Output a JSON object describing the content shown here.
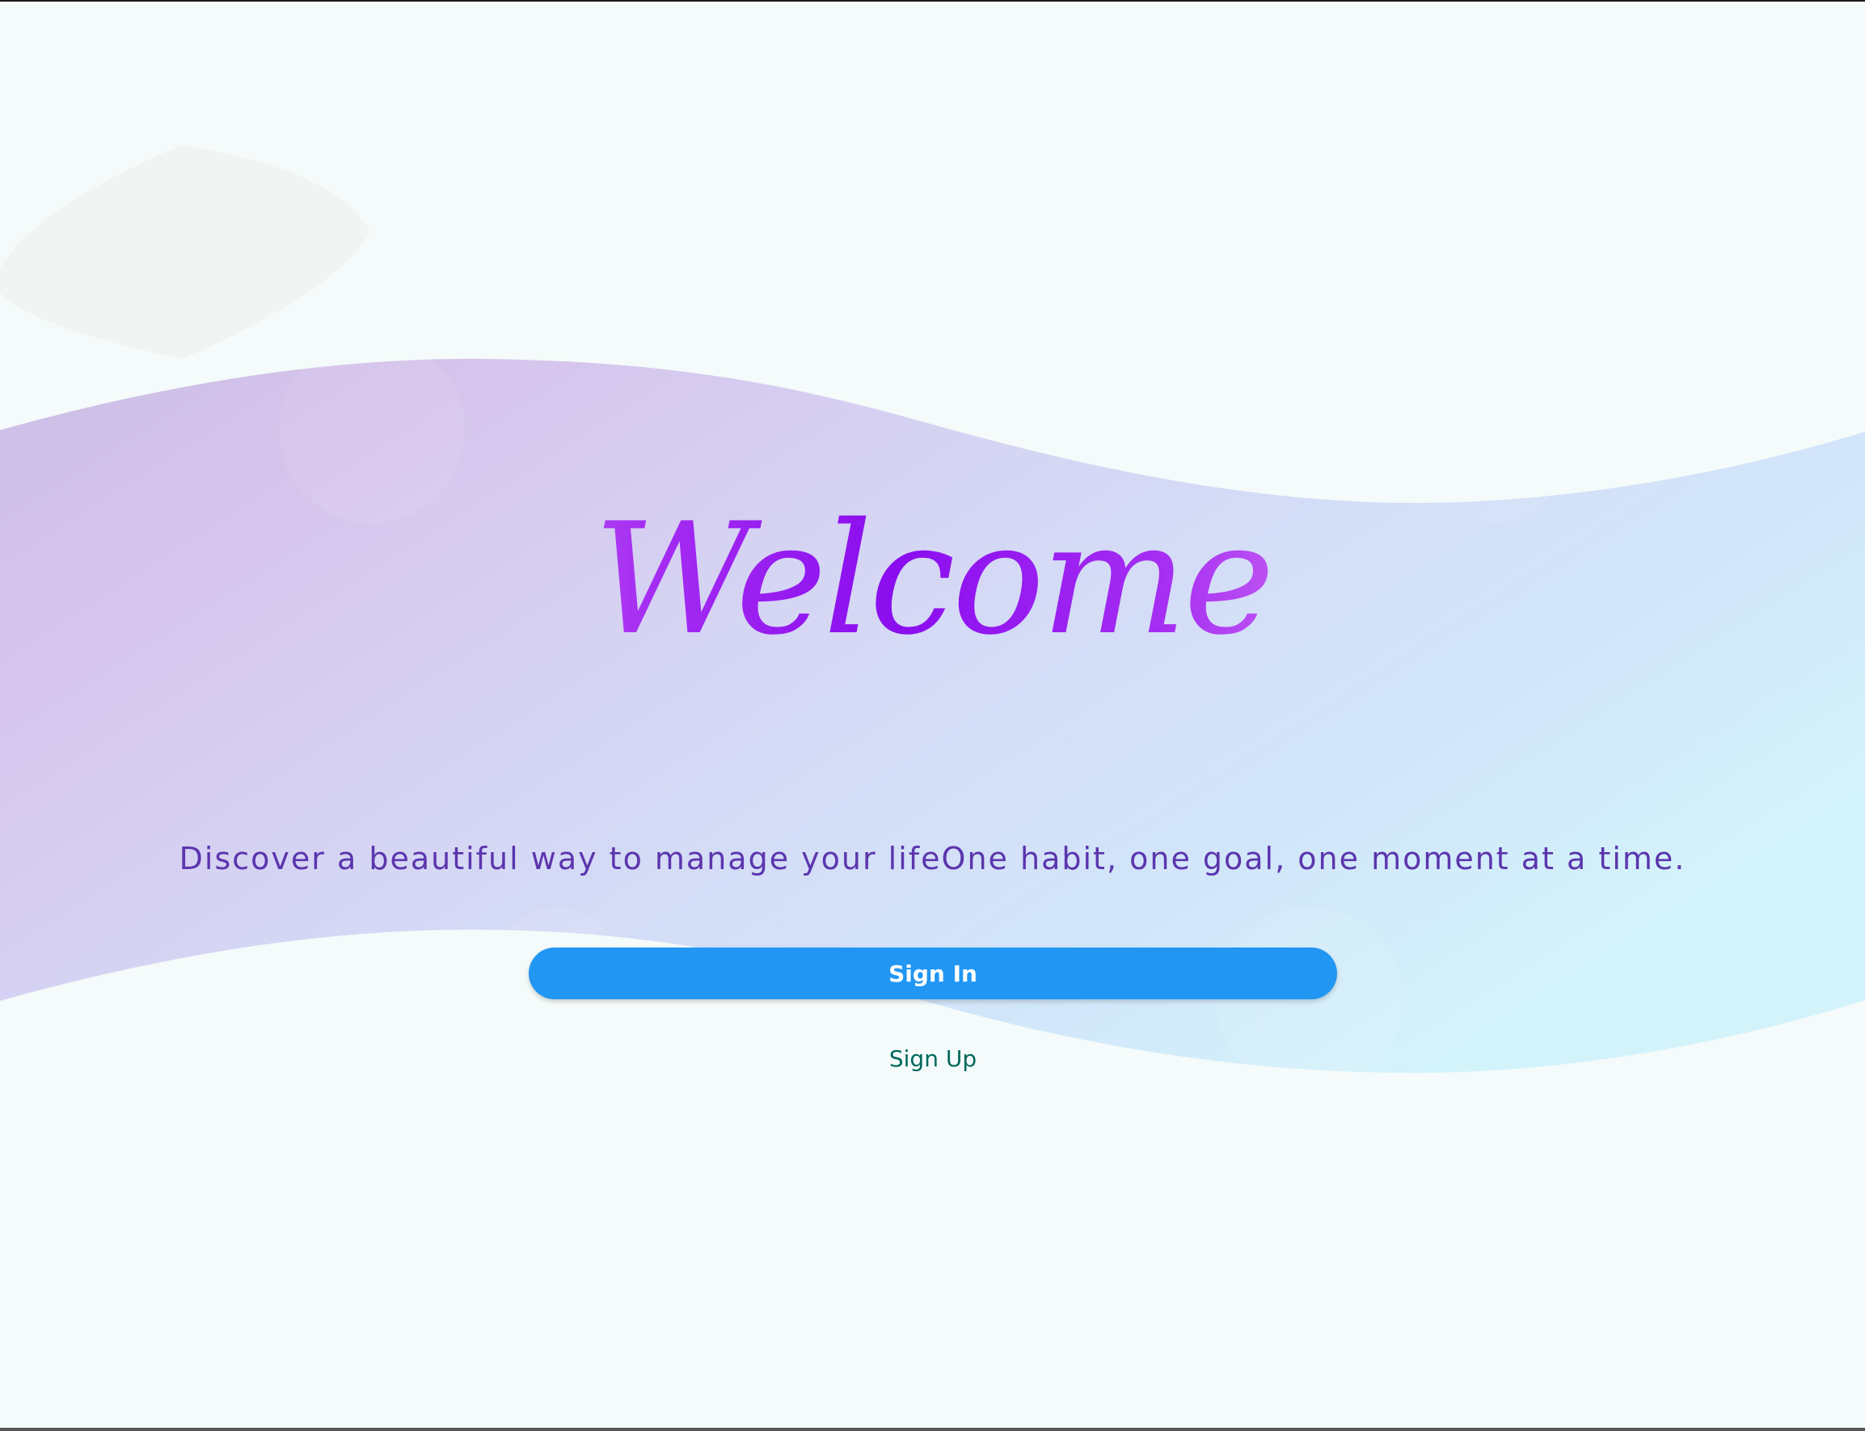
{
  "welcome": {
    "title": "Welcome",
    "tagline": "Discover a beautiful way to manage your lifeOne habit, one goal, one moment at a time."
  },
  "actions": {
    "sign_in_label": "Sign In",
    "sign_up_label": "Sign Up"
  },
  "colors": {
    "page_background": "#f4fbfa",
    "primary_button": "#2196f3",
    "tagline_text": "#5b35ad",
    "link_text": "#00695c",
    "title_gradient": [
      "#f0a6f5",
      "#8a0dee",
      "#f7d0fa"
    ]
  }
}
